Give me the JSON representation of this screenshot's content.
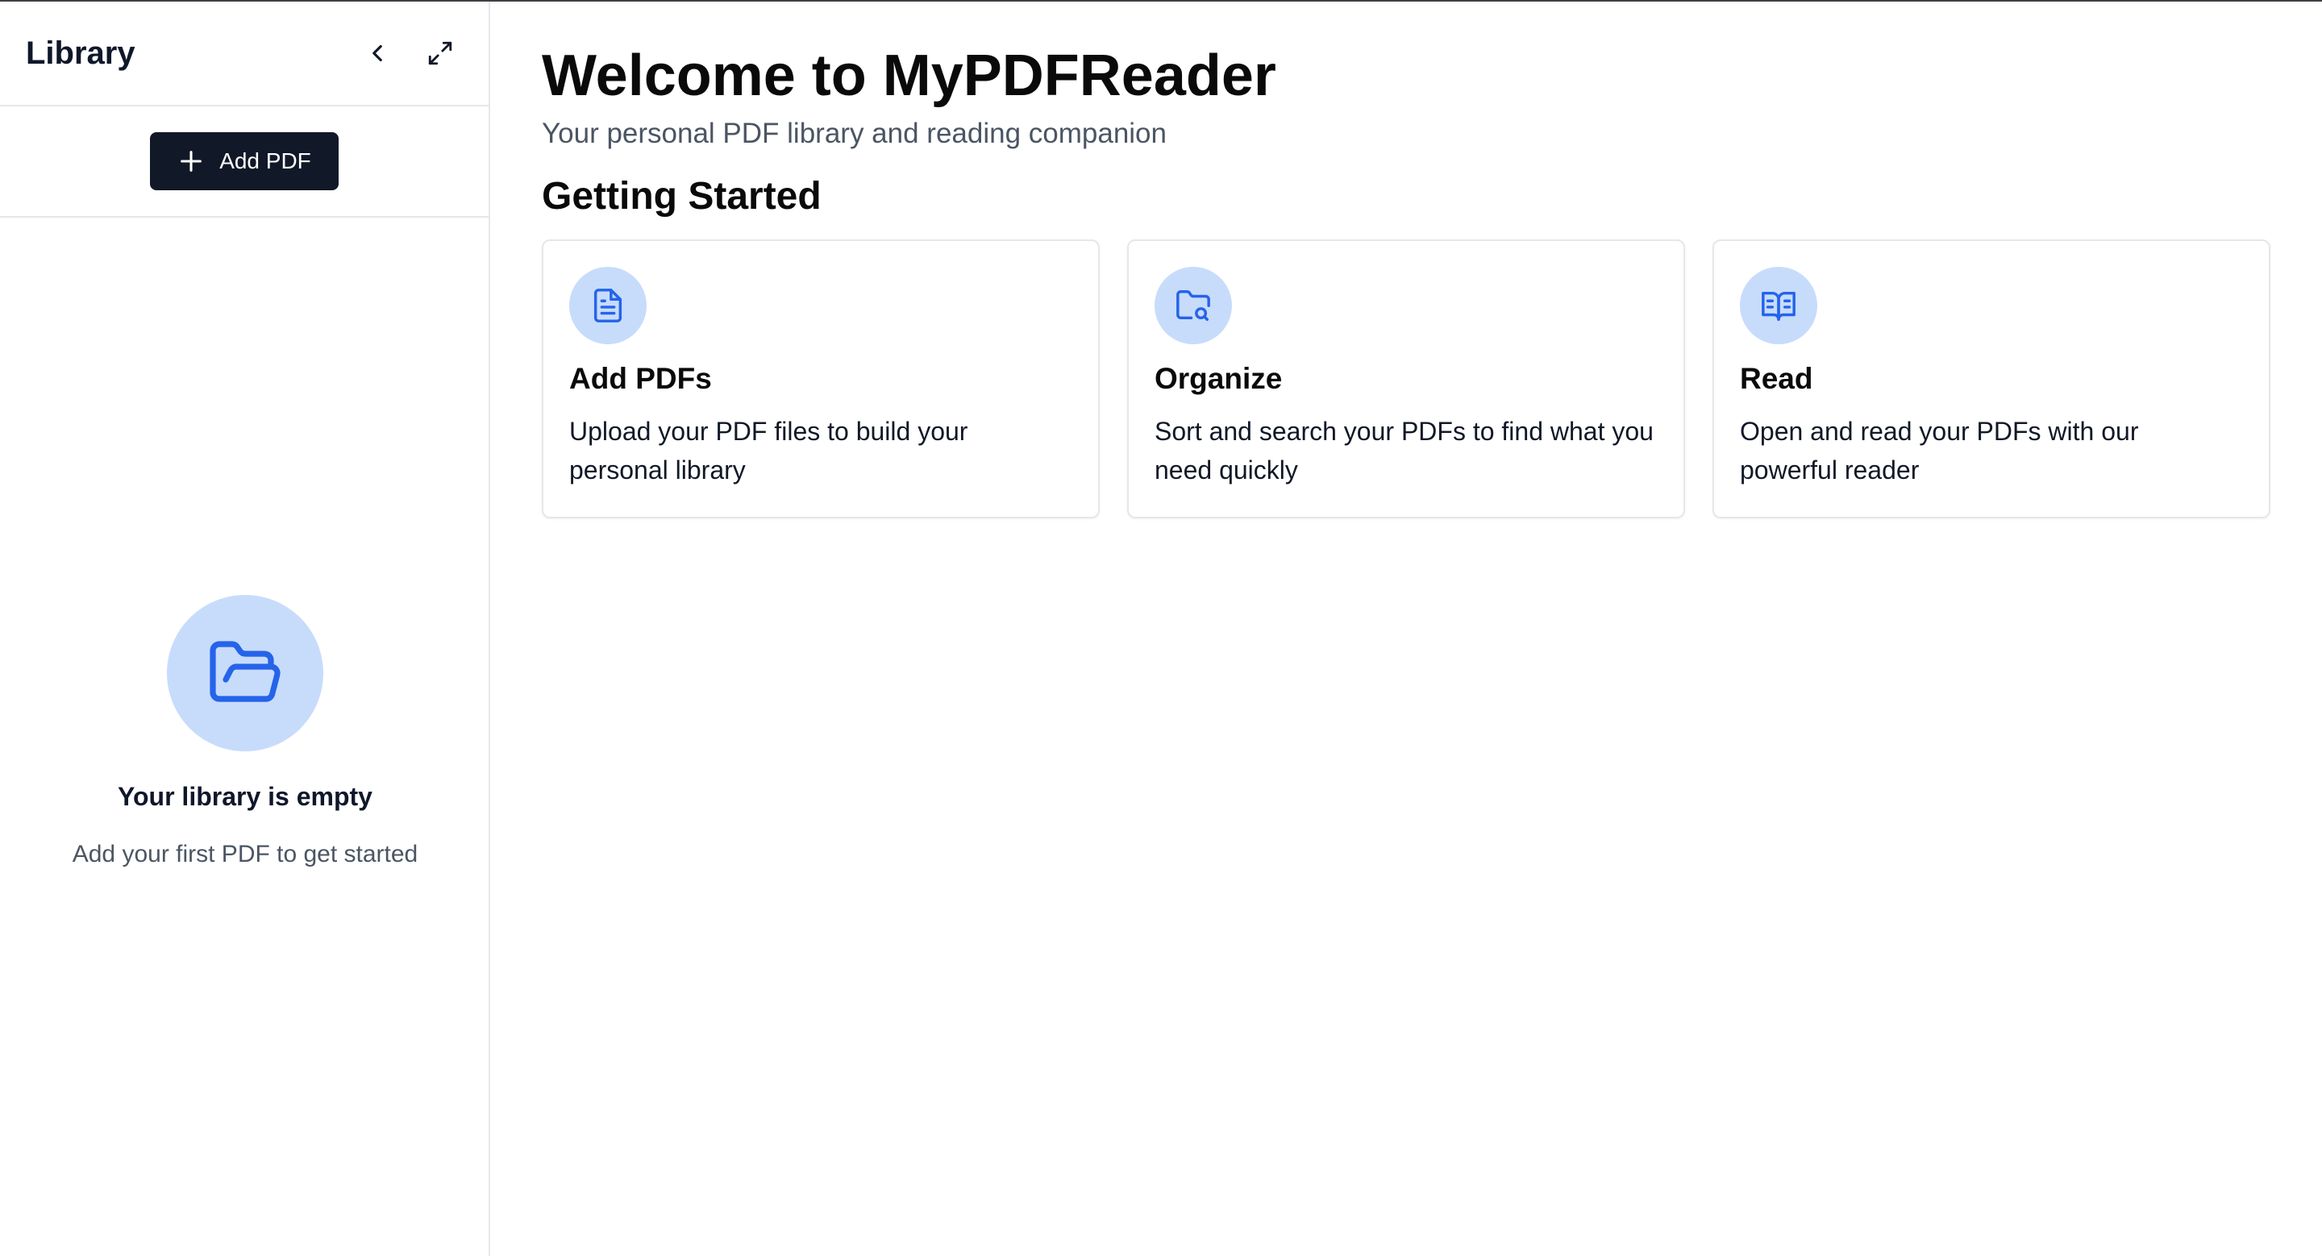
{
  "colors": {
    "accent": "#2563eb",
    "accent_soft": "#c7dcfb",
    "primary_button": "#111827",
    "border": "#e5e7eb",
    "muted_text": "#4b5563"
  },
  "sidebar": {
    "title": "Library",
    "collapse_icon": "chevron-left-icon",
    "expand_icon": "expand-icon",
    "add_button": {
      "icon": "plus-icon",
      "label": "Add PDF"
    },
    "empty_state": {
      "icon": "folder-open-icon",
      "title": "Your library is empty",
      "subtitle": "Add your first PDF to get started"
    }
  },
  "main": {
    "title": "Welcome to MyPDFReader",
    "subtitle": "Your personal PDF library and reading companion",
    "section_title": "Getting Started",
    "cards": [
      {
        "icon": "file-text-icon",
        "title": "Add PDFs",
        "description": "Upload your PDF files to build your personal library"
      },
      {
        "icon": "folder-search-icon",
        "title": "Organize",
        "description": "Sort and search your PDFs to find what you need quickly"
      },
      {
        "icon": "book-open-icon",
        "title": "Read",
        "description": "Open and read your PDFs with our powerful reader"
      }
    ]
  }
}
